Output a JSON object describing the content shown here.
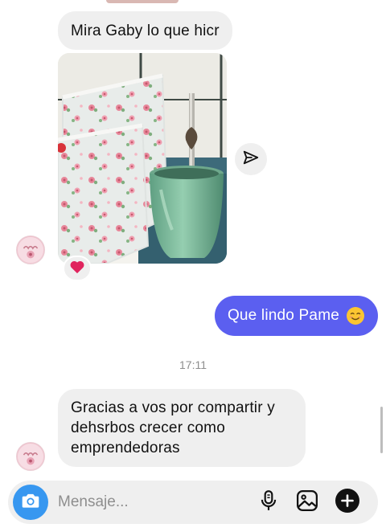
{
  "conversation": {
    "messages": [
      {
        "from": "other",
        "type": "text",
        "text": "Mira Gaby lo que hicr"
      },
      {
        "from": "other",
        "type": "image",
        "reaction": "heart"
      },
      {
        "from": "me",
        "type": "text",
        "text": "Que lindo Pame",
        "emoji": "smiling-face-icon"
      },
      {
        "from": "other",
        "type": "text",
        "text": "Gracias a vos por compartir y dehsrbos crecer como emprendedoras"
      }
    ],
    "timestamp": "17:11"
  },
  "composer": {
    "placeholder": "Mensaje...",
    "value": ""
  },
  "icons": {
    "share": "paper-plane-icon",
    "camera": "camera-icon",
    "mic": "microphone-icon",
    "gallery": "gallery-icon",
    "add": "plus-icon",
    "reaction": "heart-icon"
  },
  "colors": {
    "outgoing_bubble": "#5b5ff0",
    "incoming_bubble": "#efefef",
    "camera_button": "#3797f0",
    "reaction_heart": "#e0245e",
    "timestamp_text": "#8e8e8e"
  }
}
